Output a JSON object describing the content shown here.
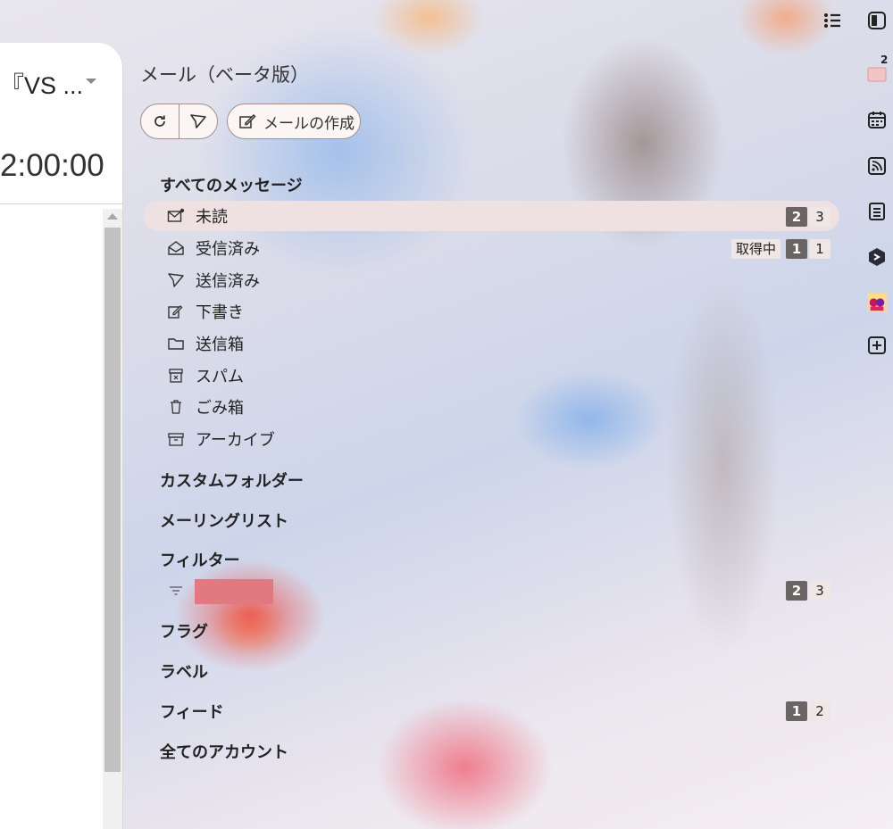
{
  "left_window": {
    "title": "『VS ...",
    "time": "2:00:00"
  },
  "panel": {
    "title": "メール（ベータ版）",
    "compose_label": "メールの作成"
  },
  "sections": {
    "all_messages": "すべてのメッセージ",
    "custom_folders": "カスタムフォルダー",
    "mailing_list": "メーリングリスト",
    "filters": "フィルター",
    "flags": "フラグ",
    "labels": "ラベル",
    "feeds": "フィード",
    "all_accounts": "全てのアカウント"
  },
  "folders": [
    {
      "label": "未読",
      "icon": "mail-unread-icon",
      "unread": "2",
      "total": "3"
    },
    {
      "label": "受信済み",
      "icon": "mail-open-icon",
      "status": "取得中",
      "unread": "1",
      "total": "1"
    },
    {
      "label": "送信済み",
      "icon": "send-icon"
    },
    {
      "label": "下書き",
      "icon": "edit-icon"
    },
    {
      "label": "送信箱",
      "icon": "folder-icon"
    },
    {
      "label": "スパム",
      "icon": "spam-icon"
    },
    {
      "label": "ごみ箱",
      "icon": "trash-icon"
    },
    {
      "label": "アーカイブ",
      "icon": "archive-icon"
    }
  ],
  "filter_item": {
    "icon": "filter-icon",
    "unread": "2",
    "total": "3"
  },
  "feeds_counts": {
    "unread": "1",
    "total": "2"
  },
  "right_bar": {
    "mail_badge": "2",
    "icons": [
      "list-icon",
      "panel-toggle-icon",
      "mail-icon",
      "calendar-icon",
      "feed-icon",
      "notes-icon",
      "translate-icon",
      "avatar-icon",
      "add-panel-icon"
    ]
  },
  "colors": {
    "selected_bg": "#efe1e1",
    "badge_dark": "#6a6464",
    "badge_light": "#efe7e5",
    "button_border": "#a58f8f"
  }
}
